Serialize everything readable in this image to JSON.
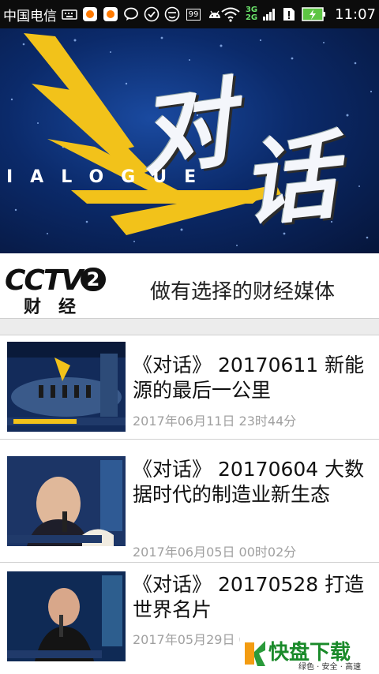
{
  "status_bar": {
    "carrier": "中国电信",
    "badge_99": "99",
    "network_3g": "3G",
    "network_2g": "2G",
    "time": "11:07"
  },
  "banner": {
    "title_char1": "对",
    "title_char2": "话",
    "subtitle": "IALOGUE"
  },
  "brand": {
    "logo_text": "CCTV",
    "logo_number": "2",
    "logo_sub": "财经",
    "slogan": "做有选择的财经媒体"
  },
  "items": [
    {
      "title": "《对话》 20170611 新能源的最后一公里",
      "date": "2017年06月11日 23时44分"
    },
    {
      "title": "《对话》 20170604 大数据时代的制造业新生态",
      "date": "2017年06月05日 00时02分"
    },
    {
      "title": "《对话》 20170528 打造世界名片",
      "date": "2017年05月29日 0"
    }
  ],
  "watermark": {
    "main": "快盘下载",
    "sub": "绿色 · 安全 · 高速"
  },
  "colors": {
    "status_bg": "#0c0c0c",
    "banner_blue": "#0b2a6a",
    "gold": "#f2c21a",
    "date_gray": "#a0a0a0"
  }
}
